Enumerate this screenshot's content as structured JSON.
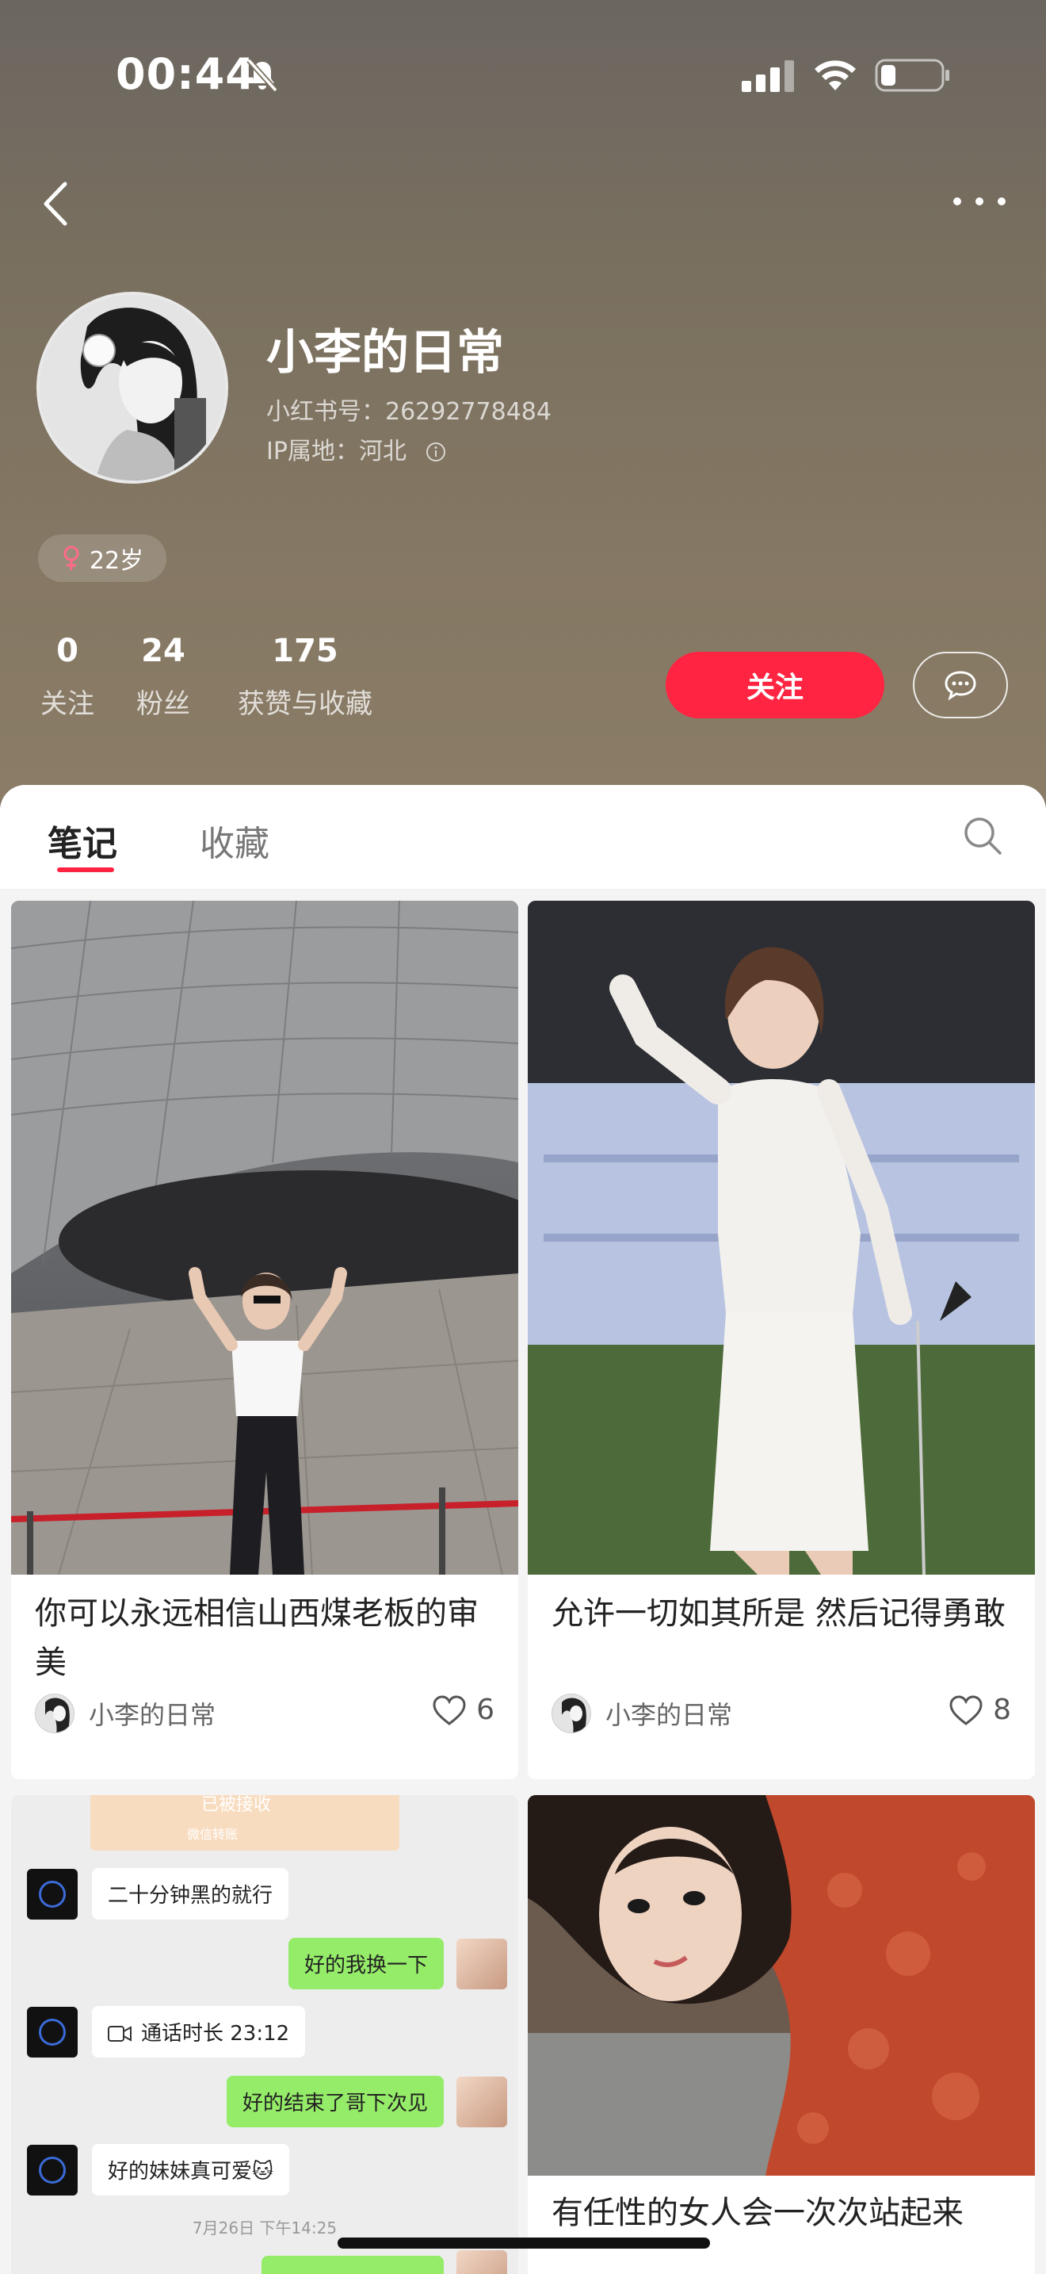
{
  "status_bar": {
    "time": "00:44",
    "icons": [
      "bell-slash-icon",
      "cellular-signal-icon",
      "wifi-icon",
      "battery-icon"
    ]
  },
  "nav": {
    "back_icon": "chevron-left-icon",
    "more_icon": "more-horizontal-icon"
  },
  "profile": {
    "name": "小李的日常",
    "id_text": "小红书号：26292778484",
    "ip_text": "IP属地：河北",
    "age_text": "22岁",
    "gender_icon": "female-icon"
  },
  "stats": [
    {
      "value": "0",
      "label": "关注"
    },
    {
      "value": "24",
      "label": "粉丝"
    },
    {
      "value": "175",
      "label": "获赞与收藏"
    }
  ],
  "actions": {
    "follow_label": "关注",
    "message_icon": "chat-bubble-icon"
  },
  "tabs": [
    {
      "label": "笔记",
      "active": true
    },
    {
      "label": "收藏",
      "active": false
    }
  ],
  "notes": [
    {
      "title": "你可以永远相信山西煤老板的审美",
      "author": "小李的日常",
      "likes": "6"
    },
    {
      "title": "允许一切如其所是 然后记得勇敢",
      "author": "小李的日常",
      "likes": "8"
    },
    {
      "chat": {
        "transfer_text": "已被接收",
        "transfer_sub": "微信转账",
        "msg1": "二十分钟黑的就行",
        "msg2": "好的我换一下",
        "call_text": "通话时长 23:12",
        "msg3": "好的结束了哥下次见",
        "msg4": "好的妹妹真可爱🐱",
        "timestamp": "7月26日 下午14:25"
      }
    },
    {
      "title": "有任性的女人会一次次站起来"
    }
  ],
  "colors": {
    "accent": "#ff2442",
    "header_bg": "#7d7262",
    "sheet_bg": "#f4f4f4",
    "chat_green": "#95ec69"
  }
}
